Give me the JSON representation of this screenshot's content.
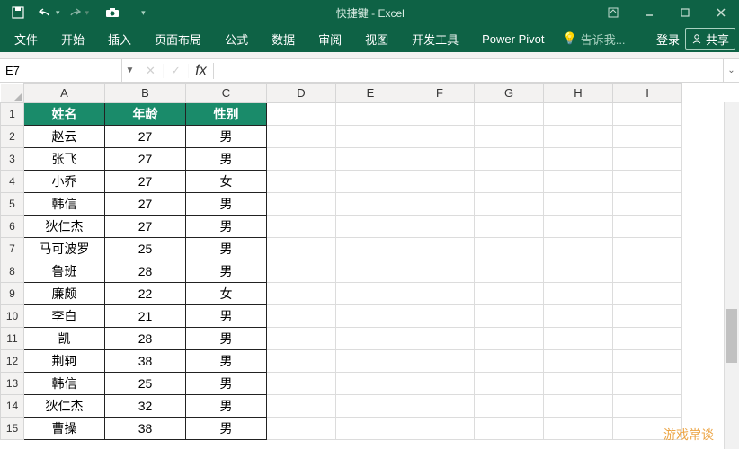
{
  "title": "快捷键 - Excel",
  "qat": {
    "save": "save-icon",
    "undo": "undo-icon",
    "redo": "redo-icon",
    "camera": "camera-icon"
  },
  "window_controls": {
    "ribbon_opts": "ribbon-options",
    "min": "minimize",
    "max": "restore",
    "close": "close"
  },
  "ribbon_tabs": [
    "文件",
    "开始",
    "插入",
    "页面布局",
    "公式",
    "数据",
    "审阅",
    "视图",
    "开发工具",
    "Power Pivot"
  ],
  "tell_me": "告诉我...",
  "login": "登录",
  "share": "共享",
  "name_box": "E7",
  "formula_bar": "",
  "fx": {
    "cancel": "✕",
    "enter": "✓",
    "fx": "fx"
  },
  "columns": [
    "A",
    "B",
    "C",
    "D",
    "E",
    "F",
    "G",
    "H",
    "I"
  ],
  "header_row": [
    "姓名",
    "年龄",
    "性别"
  ],
  "rows": [
    {
      "n": 1,
      "v": [
        "姓名",
        "年龄",
        "性别"
      ],
      "hdr": true
    },
    {
      "n": 2,
      "v": [
        "赵云",
        "27",
        "男"
      ]
    },
    {
      "n": 3,
      "v": [
        "张飞",
        "27",
        "男"
      ]
    },
    {
      "n": 4,
      "v": [
        "小乔",
        "27",
        "女"
      ]
    },
    {
      "n": 5,
      "v": [
        "韩信",
        "27",
        "男"
      ]
    },
    {
      "n": 6,
      "v": [
        "狄仁杰",
        "27",
        "男"
      ]
    },
    {
      "n": 7,
      "v": [
        "马可波罗",
        "25",
        "男"
      ]
    },
    {
      "n": 8,
      "v": [
        "鲁班",
        "28",
        "男"
      ]
    },
    {
      "n": 9,
      "v": [
        "廉颇",
        "22",
        "女"
      ]
    },
    {
      "n": 10,
      "v": [
        "李白",
        "21",
        "男"
      ]
    },
    {
      "n": 11,
      "v": [
        "凯",
        "28",
        "男"
      ]
    },
    {
      "n": 12,
      "v": [
        "荆轲",
        "38",
        "男"
      ]
    },
    {
      "n": 13,
      "v": [
        "韩信",
        "25",
        "男"
      ]
    },
    {
      "n": 14,
      "v": [
        "狄仁杰",
        "32",
        "男"
      ]
    },
    {
      "n": 15,
      "v": [
        "曹操",
        "38",
        "男"
      ]
    }
  ],
  "watermark": "游戏常谈"
}
